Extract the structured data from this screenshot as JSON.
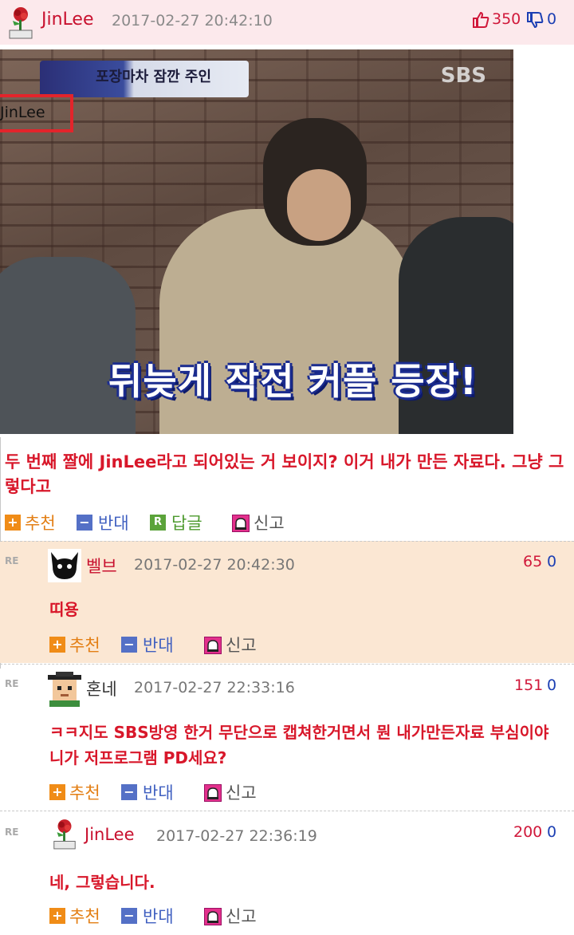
{
  "post": {
    "author": "JinLee",
    "date": "2017-02-27 20:42:10",
    "upvotes": "350",
    "downvotes": "0",
    "image": {
      "banner": "포장마차 잠깐 주인",
      "watermark": "SBS",
      "tag": "JinLee",
      "caption": "뒤늦게 작전 커플 등장!"
    },
    "text": "두 번째 짤에 JinLee라고 되어있는 거 보이지? 이거 내가 만든 자료다. 그냥 그렇다고"
  },
  "actions": {
    "recommend": "추천",
    "oppose": "반대",
    "reply_icon": "R",
    "reply": "답글",
    "report": "신고"
  },
  "comments": [
    {
      "re": "RE",
      "author": "벨브",
      "date": "2017-02-27 20:42:30",
      "upvotes": "65",
      "downvotes": "0",
      "text": "띠용"
    },
    {
      "re": "RE",
      "author": "혼네",
      "date": "2017-02-27 22:33:16",
      "upvotes": "151",
      "downvotes": "0",
      "text": "ㅋㅋ지도 SBS방영 한거 무단으로 캡쳐한거면서 뭔 내가만든자료 부심이야 니가 저프로그램 PD세요?"
    },
    {
      "re": "RE",
      "author": "JinLee",
      "date": "2017-02-27 22:36:19",
      "upvotes": "200",
      "downvotes": "0",
      "text": "네, 그렇습니다."
    }
  ],
  "colors": {
    "accent": "#d8172a",
    "header_bg": "#fce9ec",
    "highlight_bg": "#fbe7d3"
  },
  "icons": [
    "rose-avatar-icon",
    "thumbs-up-icon",
    "thumbs-down-icon",
    "plus-icon",
    "minus-icon",
    "reply-icon",
    "report-icon",
    "cat-avatar-icon",
    "pixel-avatar-icon"
  ]
}
